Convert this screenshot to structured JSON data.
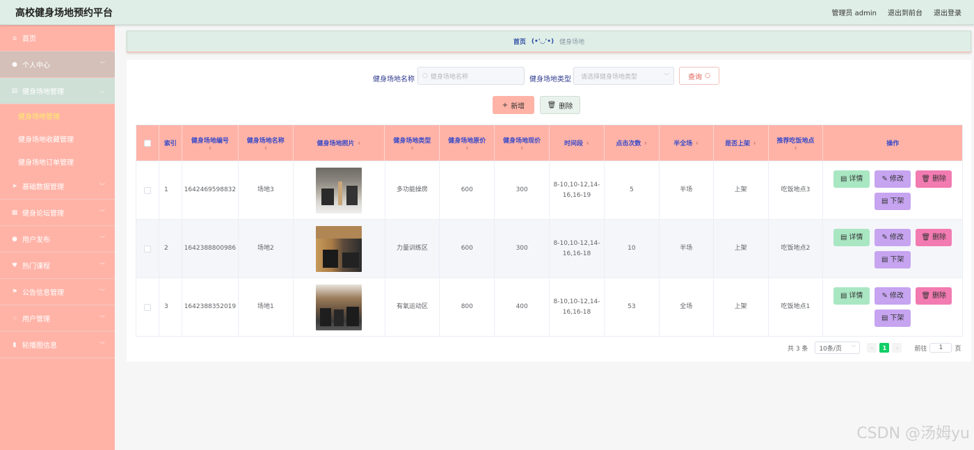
{
  "app": {
    "title": "高校健身场地预约平台",
    "top_links": [
      "管理员 admin",
      "退出到前台",
      "退出登录"
    ]
  },
  "sidebar": {
    "items": [
      {
        "label": "首页",
        "icon": "home-icon",
        "chevron": false
      },
      {
        "label": "个人中心",
        "icon": "user-icon",
        "chevron": true
      },
      {
        "label": "健身场地管理",
        "icon": "table-icon",
        "chevron": true,
        "open": true
      },
      {
        "label": "基础数据管理",
        "icon": "send-icon",
        "chevron": true
      },
      {
        "label": "健身论坛管理",
        "icon": "grid-icon",
        "chevron": true
      },
      {
        "label": "用户发布",
        "icon": "user-icon",
        "chevron": true
      },
      {
        "label": "热门课程",
        "icon": "heart-icon",
        "chevron": true
      },
      {
        "label": "公告信息管理",
        "icon": "flag-icon",
        "chevron": true
      },
      {
        "label": "用户管理",
        "icon": "apps-icon",
        "chevron": true
      },
      {
        "label": "轮播图信息",
        "icon": "chart-icon",
        "chevron": true
      }
    ],
    "submenu": [
      "健身场地管理",
      "健身场地收藏管理",
      "健身场地订单管理"
    ]
  },
  "breadcrumb": {
    "home": "首页",
    "sep": "(•'◡'•)",
    "current": "健身场地"
  },
  "search": {
    "name_label": "健身场地名称",
    "name_placeholder": "健身场地名称",
    "type_label": "健身场地类型",
    "type_placeholder": "请选择健身场地类型",
    "query_label": "查询"
  },
  "actions": {
    "add_label": "新增",
    "delete_label": "删除"
  },
  "table": {
    "headers": [
      "索引",
      "健身场地编号",
      "健身场地名称",
      "健身场地照片",
      "健身场地类型",
      "健身场地原价",
      "健身场地现价",
      "时间段",
      "点击次数",
      "半全场",
      "是否上架",
      "推荐吃饭地点",
      "操作"
    ],
    "rows": [
      {
        "index": "1",
        "code": "1642469598832",
        "name": "场地3",
        "type": "多功能操房",
        "orig": "600",
        "now": "300",
        "time": "8-10,10-12,14-16,16-19",
        "clicks": "5",
        "half": "半场",
        "shelf": "上架",
        "food": "吃饭地点3"
      },
      {
        "index": "2",
        "code": "1642388800986",
        "name": "场地2",
        "type": "力量训练区",
        "orig": "600",
        "now": "300",
        "time": "8-10,10-12,14-16,16-18",
        "clicks": "10",
        "half": "半场",
        "shelf": "上架",
        "food": "吃饭地点2"
      },
      {
        "index": "3",
        "code": "1642388352019",
        "name": "场地1",
        "type": "有氧运动区",
        "orig": "800",
        "now": "400",
        "time": "8-10,10-12,14-16,16-18",
        "clicks": "53",
        "half": "全场",
        "shelf": "上架",
        "food": "吃饭地点1"
      }
    ],
    "op_labels": {
      "detail": "详情",
      "edit": "修改",
      "delete": "删除",
      "off": "下架"
    }
  },
  "pagination": {
    "total": "共 3 条",
    "page_size": "10条/页",
    "current": "1",
    "goto_label": "前往",
    "goto_value": "1",
    "page_unit": "页"
  },
  "watermark": "CSDN @汤姆yu"
}
